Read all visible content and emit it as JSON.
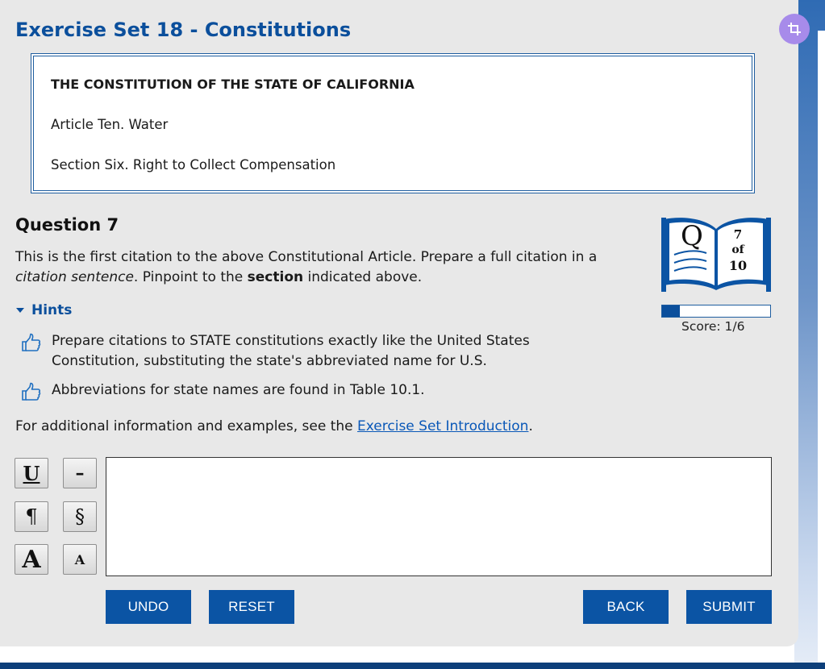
{
  "header": {
    "title": "Exercise Set 18 - Constitutions"
  },
  "article": {
    "heading": "THE CONSTITUTION OF THE STATE OF CALIFORNIA",
    "article_line": "Article Ten. Water",
    "section_line": "Section Six. Right to Collect Compensation"
  },
  "question": {
    "title": "Question 7",
    "prompt_part1": "This is the first citation to the above Constitutional Article. Prepare a full citation in a ",
    "prompt_italic": "citation sentence",
    "prompt_part2": ". Pinpoint to the ",
    "prompt_bold": "section",
    "prompt_part3": " indicated above."
  },
  "hints": {
    "toggle_label": "Hints",
    "items": [
      {
        "text": "Prepare citations to STATE constitutions exactly like the United States Constitution, substituting the state's abbreviated name for U.S."
      },
      {
        "text": "Abbreviations for state names are found in Table 10.1."
      }
    ]
  },
  "additional": {
    "text": "For additional information and examples, see the ",
    "link_text": "Exercise Set Introduction",
    "suffix": "."
  },
  "progress": {
    "book_letter": "Q",
    "current": "7",
    "of_label": "of",
    "total": "10",
    "score_label": "Score: 1/6",
    "fraction": 0.167
  },
  "format_buttons": {
    "underline": "U",
    "dash": "–",
    "paragraph": "¶",
    "section": "§",
    "large_caps": "A",
    "small_caps": "A"
  },
  "answer": {
    "value": "",
    "placeholder": ""
  },
  "actions": {
    "undo": "UNDO",
    "reset": "RESET",
    "back": "BACK",
    "submit": "SUBMIT"
  },
  "icons": {
    "hint": "thumbs-up-outline-icon",
    "toggle": "caret-down-icon",
    "book": "open-book-icon",
    "badge": "crop-icon"
  },
  "colors": {
    "accent": "#0b4f9c",
    "panel": "#e8e8e8",
    "badge": "#a78bea"
  }
}
